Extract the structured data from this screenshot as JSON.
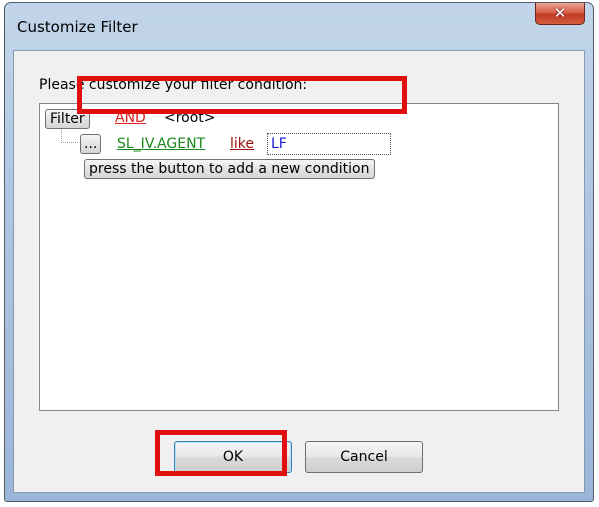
{
  "window": {
    "title": "Customize Filter",
    "close_icon": "✕"
  },
  "dialog": {
    "prompt": "Please customize your filter condition:",
    "tree": {
      "filter_button": "Filter",
      "group_operator": "AND",
      "root_label": "<root>",
      "condition": {
        "menu_button": "...",
        "field": "SL_IV.AGENT",
        "operator": "like",
        "value": "LF"
      },
      "add_condition_button": "press the button to add a new condition"
    },
    "ok_button": "OK",
    "cancel_button": "Cancel"
  },
  "colors": {
    "highlight": "#e01010",
    "group_operator": "#e02020",
    "field": "#1a8a1a",
    "operator": "#a01010",
    "value": "#1a1ad0"
  }
}
